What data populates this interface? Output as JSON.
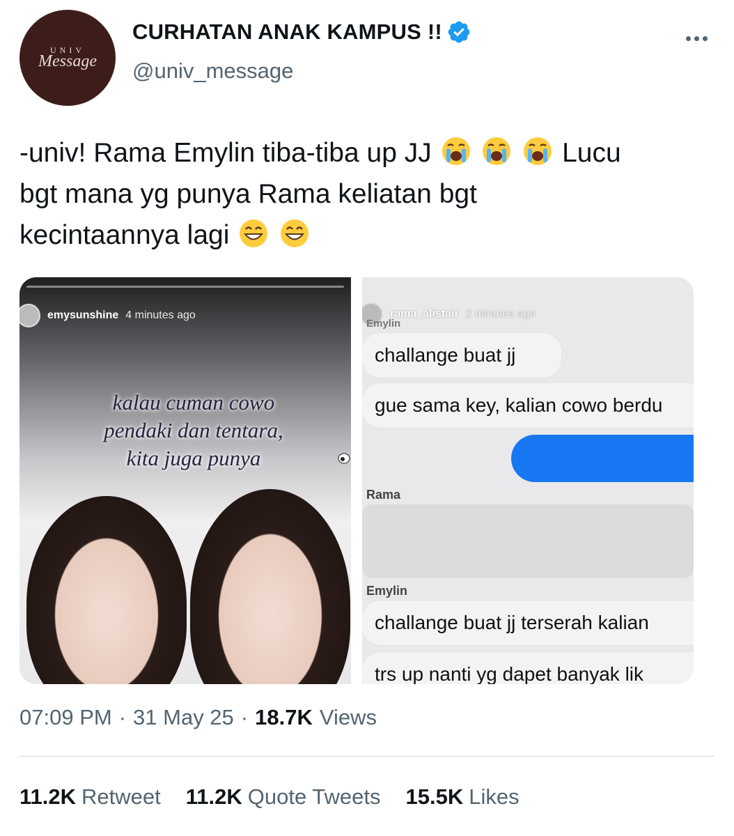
{
  "header": {
    "avatar_text_top": "UNIV",
    "avatar_text_bottom": "Message",
    "display_name": "CURHATAN ANAK KAMPUS !!",
    "handle": "@univ_message",
    "verified_color": "#1d9bf0"
  },
  "tweet": {
    "line1_before": "-univ! Rama Emylin tiba-tiba up JJ",
    "line1_after": "Lucu",
    "line2": "bgt mana yg punya Rama keliatan bgt",
    "line3": "kecintaannya lagi",
    "emoji_cry": "loudly-crying-face",
    "emoji_grin": "grinning-face-with-smiling-eyes"
  },
  "media": {
    "story1": {
      "user": "emysunshine",
      "time": "4 minutes ago",
      "quote_line1": "kalau cuman cowo",
      "quote_line2": "pendaki dan tentara,",
      "quote_line3": "kita juga punya"
    },
    "story2": {
      "user": "rama_alistair",
      "time": "2 minutes ago",
      "top_sender": "Emylin",
      "msg1": "challange buat jj",
      "msg2": "gue sama key, kalian cowo berdu",
      "sender_rama": "Rama",
      "sender_emylin": "Emylin",
      "msg3": "challange buat jj terserah kalian",
      "msg4": "trs up nanti yg dapet banyak lik"
    }
  },
  "footer": {
    "time": "07:09 PM",
    "date": "31 May 25",
    "views_count": "18.7K",
    "views_label": "Views",
    "sep": "·"
  },
  "stats": {
    "retweets_count": "11.2K",
    "retweets_label": "Retweet",
    "quotes_count": "11.2K",
    "quotes_label": "Quote Tweets",
    "likes_count": "15.5K",
    "likes_label": "Likes"
  },
  "colors": {
    "text": "#0f1419",
    "muted": "#536471",
    "accent": "#1d9bf0"
  }
}
